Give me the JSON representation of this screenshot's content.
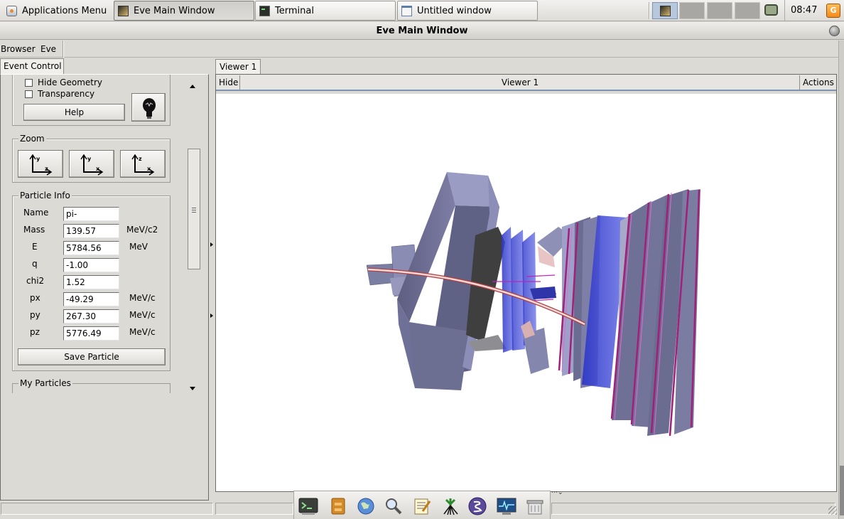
{
  "panel": {
    "apps_menu_label": "Applications Menu",
    "tasks": [
      {
        "label": "Eve Main Window",
        "icon": "eve-app-icon",
        "active": true
      },
      {
        "label": "Terminal",
        "icon": "terminal-icon",
        "active": false
      },
      {
        "label": "Untitled window",
        "icon": "window-icon",
        "active": false
      }
    ],
    "clock": "08:47",
    "notify_icon": "notification-icon"
  },
  "window": {
    "title": "Eve Main Window",
    "menu": [
      "Browser",
      "Eve"
    ]
  },
  "left_panel": {
    "tab": "Event Control",
    "checkboxes": [
      {
        "label": "Hide Geometry",
        "checked": false
      },
      {
        "label": "Transparency",
        "checked": false
      }
    ],
    "help_button": "Help",
    "bulb_icon": "lightbulb-icon",
    "zoom": {
      "title": "Zoom",
      "buttons": [
        {
          "icon": "zoom-axis-yz-icon",
          "v": "y",
          "h": "z"
        },
        {
          "icon": "zoom-axis-yx-icon",
          "v": "y",
          "h": "x"
        },
        {
          "icon": "zoom-axis-zx-icon",
          "v": "z",
          "h": "x"
        }
      ]
    },
    "particle_info": {
      "title": "Particle Info",
      "rows": [
        {
          "label": "Name",
          "value": "pi-",
          "unit": ""
        },
        {
          "label": "Mass",
          "value": "139.57",
          "unit": "MeV/c2"
        },
        {
          "label": "E",
          "value": "5784.56",
          "unit": "MeV"
        },
        {
          "label": "q",
          "value": "-1.00",
          "unit": ""
        },
        {
          "label": "chi2",
          "value": "1.52",
          "unit": ""
        },
        {
          "label": "px",
          "value": "-49.29",
          "unit": "MeV/c"
        },
        {
          "label": "py",
          "value": "267.30",
          "unit": "MeV/c"
        },
        {
          "label": "pz",
          "value": "5776.49",
          "unit": "MeV/c"
        }
      ],
      "save_button": "Save Particle"
    },
    "my_particles_title": "My Particles"
  },
  "viewer": {
    "tab": "Viewer 1",
    "hide_label": "Hide",
    "title": "Viewer 1",
    "actions_label": "Actions"
  },
  "dock": [
    "terminal-icon",
    "file-manager-icon",
    "web-browser-icon",
    "search-icon",
    "text-editor-icon",
    "root-tree-icon",
    "emacs-icon",
    "system-monitor-icon",
    "trash-icon"
  ]
}
